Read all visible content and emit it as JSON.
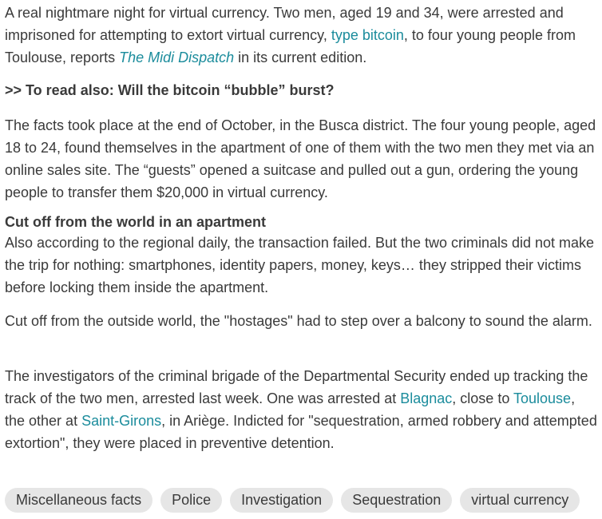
{
  "paragraph1": {
    "text_a": "A real nightmare night for virtual currency. Two men, aged 19 and 34, were arrested and imprisoned for attempting to extort virtual currency, ",
    "link_type_bitcoin": "type bitcoin",
    "text_b": ", to four young people from Toulouse, reports ",
    "link_midi_dispatch": "The Midi Dispatch",
    "text_c": " in its current edition."
  },
  "read_also": ">> To read also: Will the bitcoin “bubble” burst?",
  "paragraph2": "The facts took place at the end of October, in the Busca district. The four young people, aged 18 to 24, found themselves in the apartment of one of them with the two men they met via an online sales site. The “guests” opened a suitcase and pulled out a gun, ordering the young people to transfer them $20,000 in virtual currency.",
  "subheading": "Cut off from the world in an apartment",
  "paragraph3": "Also according to the regional daily, the transaction failed. But the two criminals did not make the trip for nothing: smartphones, identity papers, money, keys… they stripped their victims before locking them inside the apartment.",
  "paragraph4": "Cut off from the outside world, the \"hostages\" had to step over a balcony to sound the alarm.",
  "paragraph5": {
    "text_a": "The investigators of the criminal brigade of the Departmental Security ended up tracking the track of the two men, arrested last week. One was arrested at ",
    "link_blagnac": "Blagnac",
    "text_b": ", close to ",
    "link_toulouse": "Toulouse",
    "text_c": ", the other at ",
    "link_saint_girons": "Saint-Girons",
    "text_d": ", in Ariège. Indicted for \"sequestration, armed robbery and attempted extortion\", they were placed in preventive detention."
  },
  "tags": [
    "Miscellaneous facts",
    "Police",
    "Investigation",
    "Sequestration",
    "virtual currency"
  ],
  "colors": {
    "text": "#3a3a3a",
    "link": "#1b8c9c",
    "tag_background": "#e6e6e6"
  }
}
